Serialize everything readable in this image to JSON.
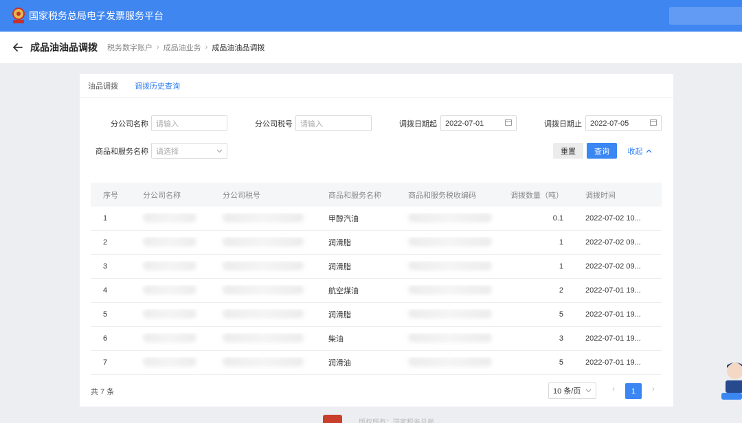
{
  "app": {
    "title": "国家税务总局电子发票服务平台"
  },
  "header": {
    "page_title": "成品油油品调拨",
    "breadcrumb": [
      "税务数字账户",
      "成品油业务",
      "成品油油品调拨"
    ]
  },
  "tabs": [
    {
      "label": "油品调拨",
      "active": false
    },
    {
      "label": "调拨历史查询",
      "active": true
    }
  ],
  "form": {
    "branch_name": {
      "label": "分公司名称",
      "placeholder": "请输入"
    },
    "branch_tax_no": {
      "label": "分公司税号",
      "placeholder": "请输入"
    },
    "date_start": {
      "label": "调拨日期起",
      "value": "2022-07-01"
    },
    "date_end": {
      "label": "调拨日期止",
      "value": "2022-07-05"
    },
    "goods_name": {
      "label": "商品和服务名称",
      "placeholder": "请选择"
    },
    "reset_label": "重置",
    "query_label": "查询",
    "collapse_label": "收起"
  },
  "table": {
    "columns": [
      "序号",
      "分公司名称",
      "分公司税号",
      "商品和服务名称",
      "商品和服务税收编码",
      "调拨数量（吨）",
      "调拨时间"
    ],
    "rows": [
      {
        "no": "1",
        "goods": "甲醇汽油",
        "qty": "0.1",
        "time": "2022-07-02 10..."
      },
      {
        "no": "2",
        "goods": "润滑脂",
        "qty": "1",
        "time": "2022-07-02 09..."
      },
      {
        "no": "3",
        "goods": "润滑脂",
        "qty": "1",
        "time": "2022-07-02 09..."
      },
      {
        "no": "4",
        "goods": "航空煤油",
        "qty": "2",
        "time": "2022-07-01 19..."
      },
      {
        "no": "5",
        "goods": "润滑脂",
        "qty": "5",
        "time": "2022-07-01 19..."
      },
      {
        "no": "6",
        "goods": "柴油",
        "qty": "3",
        "time": "2022-07-01 19..."
      },
      {
        "no": "7",
        "goods": "润滑油",
        "qty": "5",
        "time": "2022-07-01 19..."
      }
    ]
  },
  "pagination": {
    "total": "共 7 条",
    "page_size": "10 条/页",
    "current_page": "1"
  },
  "footer": {
    "text": "版权所有：国家税务总局"
  },
  "colors": {
    "primary": "#3f86f1",
    "accent": "#2b7df0"
  }
}
